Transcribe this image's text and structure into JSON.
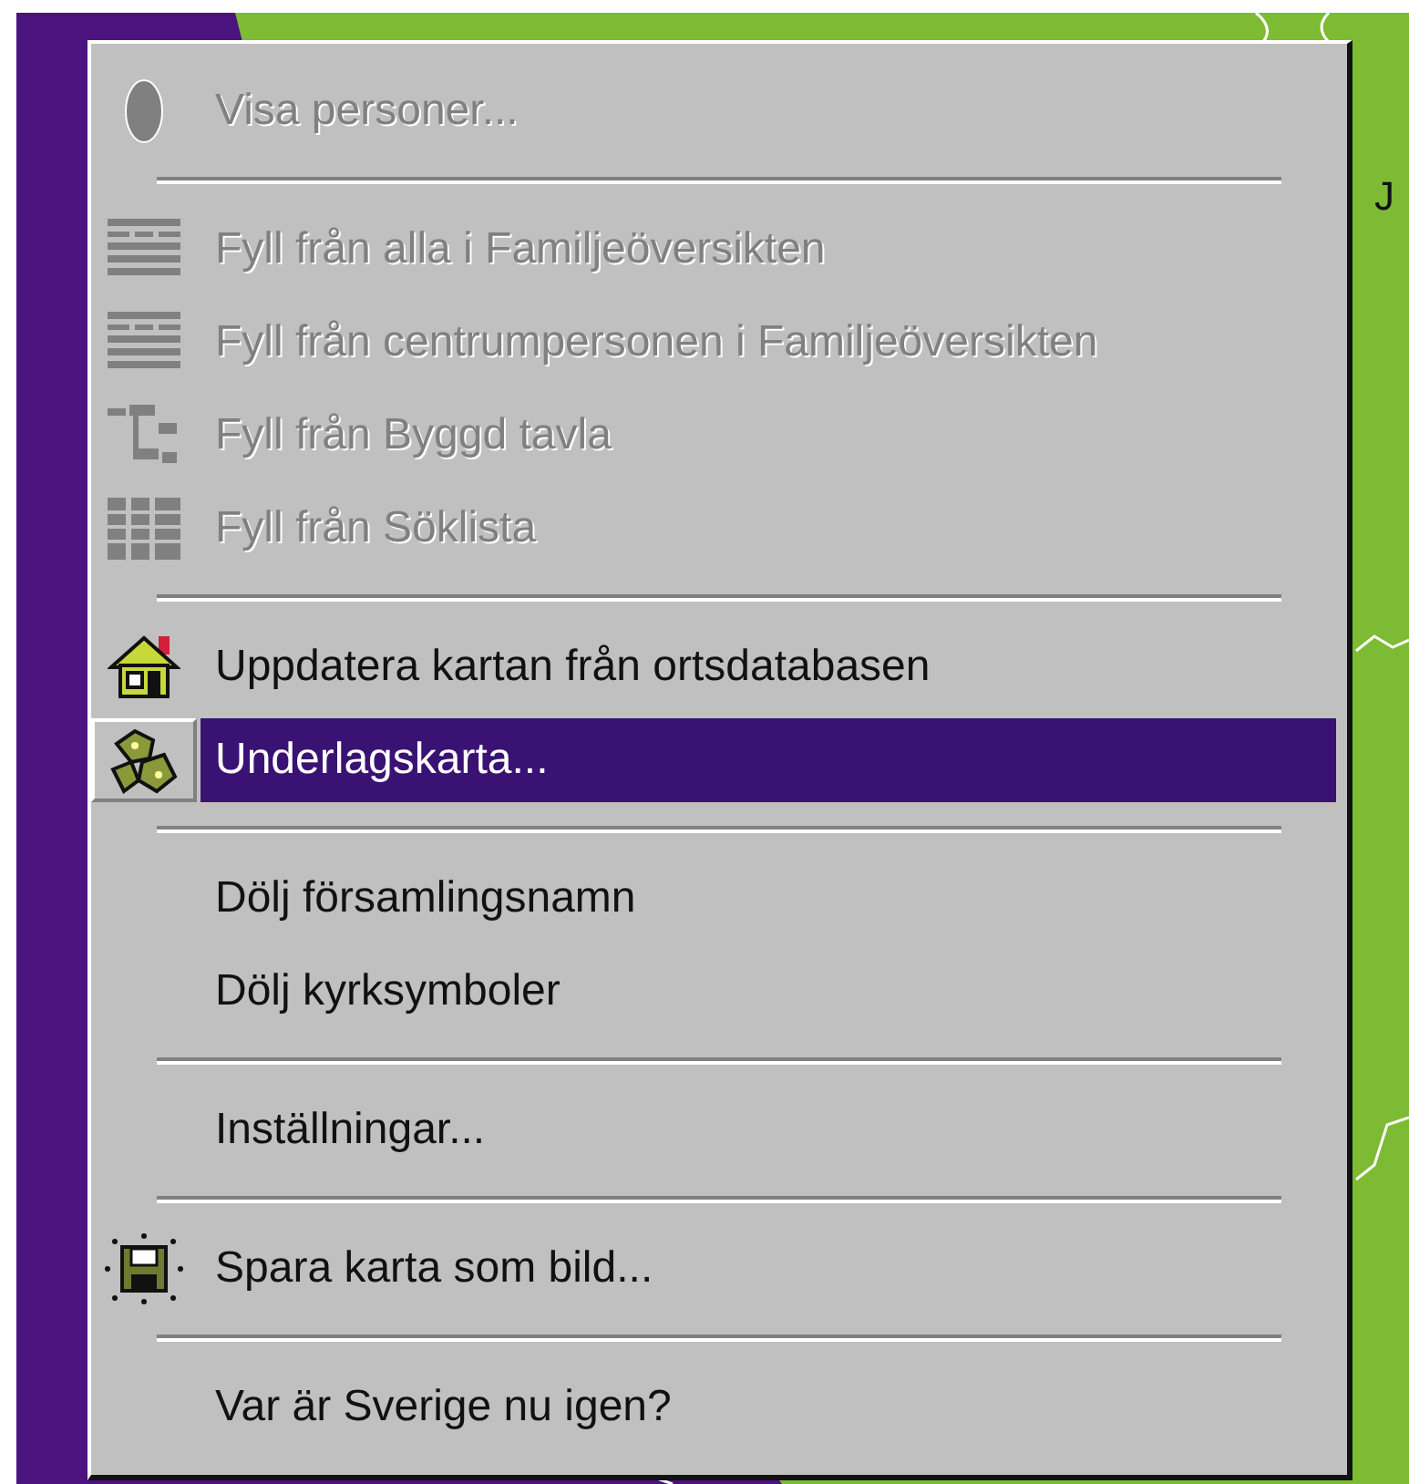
{
  "map": {
    "label": "J"
  },
  "menu": {
    "entries": [
      {
        "kind": "item",
        "label": "Visa personer...",
        "disabled": true,
        "selected": false
      },
      {
        "kind": "separator"
      },
      {
        "kind": "item",
        "label": "Fyll från alla i Familjeöversikten",
        "disabled": true,
        "selected": false
      },
      {
        "kind": "item",
        "label": "Fyll från centrumpersonen i Familjeöversikten",
        "disabled": true,
        "selected": false
      },
      {
        "kind": "item",
        "label": "Fyll från Byggd tavla",
        "disabled": true,
        "selected": false
      },
      {
        "kind": "item",
        "label": "Fyll från Söklista",
        "disabled": true,
        "selected": false
      },
      {
        "kind": "separator"
      },
      {
        "kind": "item",
        "label": "Uppdatera kartan från ortsdatabasen",
        "disabled": false,
        "selected": false
      },
      {
        "kind": "item",
        "label": "Underlagskarta...",
        "disabled": false,
        "selected": true
      },
      {
        "kind": "separator"
      },
      {
        "kind": "item",
        "label": "Dölj församlingsnamn",
        "disabled": false,
        "selected": false
      },
      {
        "kind": "item",
        "label": "Dölj kyrksymboler",
        "disabled": false,
        "selected": false
      },
      {
        "kind": "separator"
      },
      {
        "kind": "item",
        "label": "Inställningar...",
        "disabled": false,
        "selected": false
      },
      {
        "kind": "separator"
      },
      {
        "kind": "item",
        "label": "Spara karta som bild...",
        "disabled": false,
        "selected": false
      },
      {
        "kind": "separator"
      },
      {
        "kind": "item",
        "label": "Var är Sverige nu igen?",
        "disabled": false,
        "selected": false
      }
    ]
  }
}
